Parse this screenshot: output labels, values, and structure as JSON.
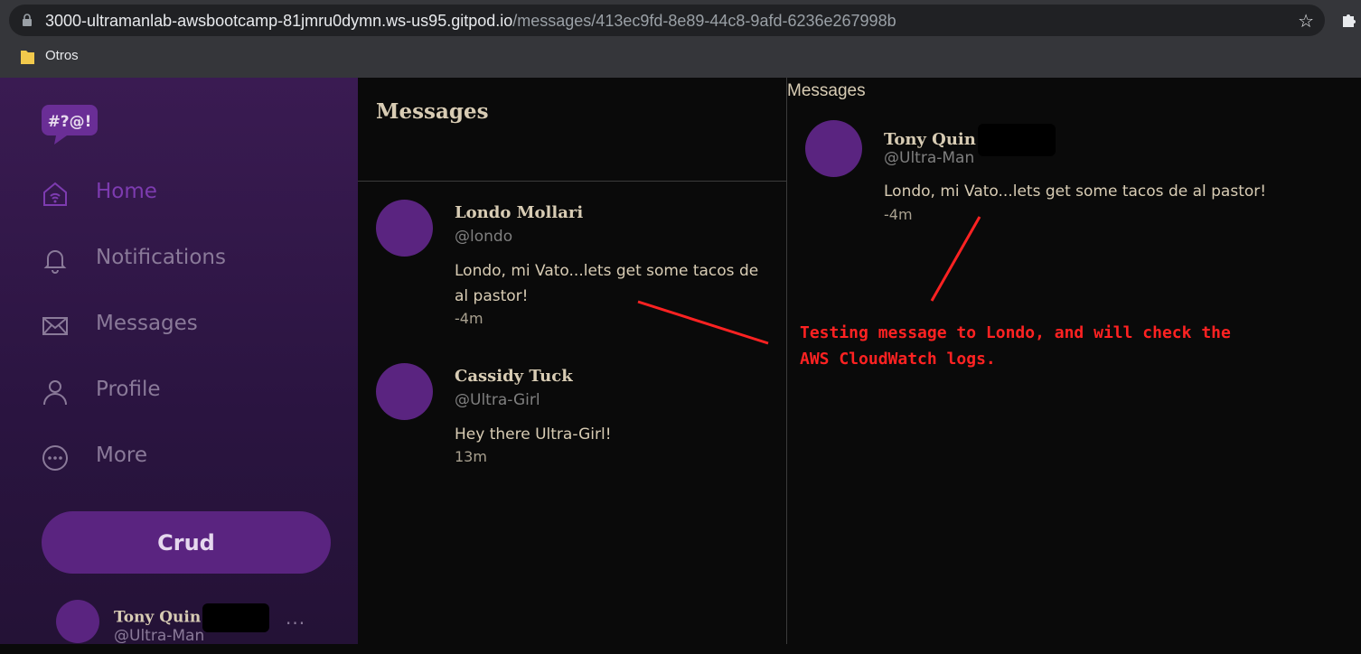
{
  "browser": {
    "url_host": "3000-ultramanlab-awsbootcamp-81jmru0dymn.ws-us95.gitpod.io",
    "url_path": "/messages/413ec9fd-8e89-44c8-9afd-6236e267998b",
    "bookmark_folder": "Otros"
  },
  "sidebar": {
    "logo_text": "#?@!",
    "items": [
      {
        "label": "Home",
        "icon": "home-icon",
        "active": true
      },
      {
        "label": "Notifications",
        "icon": "bell-icon",
        "active": false
      },
      {
        "label": "Messages",
        "icon": "envelope-icon",
        "active": false
      },
      {
        "label": "Profile",
        "icon": "person-icon",
        "active": false
      },
      {
        "label": "More",
        "icon": "more-circle-icon",
        "active": false
      }
    ],
    "crud_label": "Crud",
    "user": {
      "name": "Tony Quin",
      "handle": "@Ultra-Man",
      "more": "···"
    }
  },
  "middle": {
    "title": "Messages",
    "conversations": [
      {
        "name": "Londo Mollari",
        "handle": "@londo",
        "message": "Londo, mi Vato...lets get some tacos de al pastor!",
        "time": "-4m"
      },
      {
        "name": "Cassidy Tuck",
        "handle": "@Ultra-Girl",
        "message": "Hey there Ultra-Girl!",
        "time": "13m"
      }
    ]
  },
  "right": {
    "title": "Messages",
    "message": {
      "name": "Tony Quin",
      "handle": "@Ultra-Man",
      "text": "Londo, mi Vato...lets get some tacos de al pastor!",
      "time": "-4m"
    }
  },
  "annotation": {
    "line1": "Testing message to Londo, and will check the",
    "line2": "AWS CloudWatch logs.",
    "color": "#ff2222"
  },
  "colors": {
    "accent": "#5a2480",
    "active_nav": "#7d3bb0",
    "sidebar_bg": "#2a1440",
    "text": "#d8ccb4"
  }
}
